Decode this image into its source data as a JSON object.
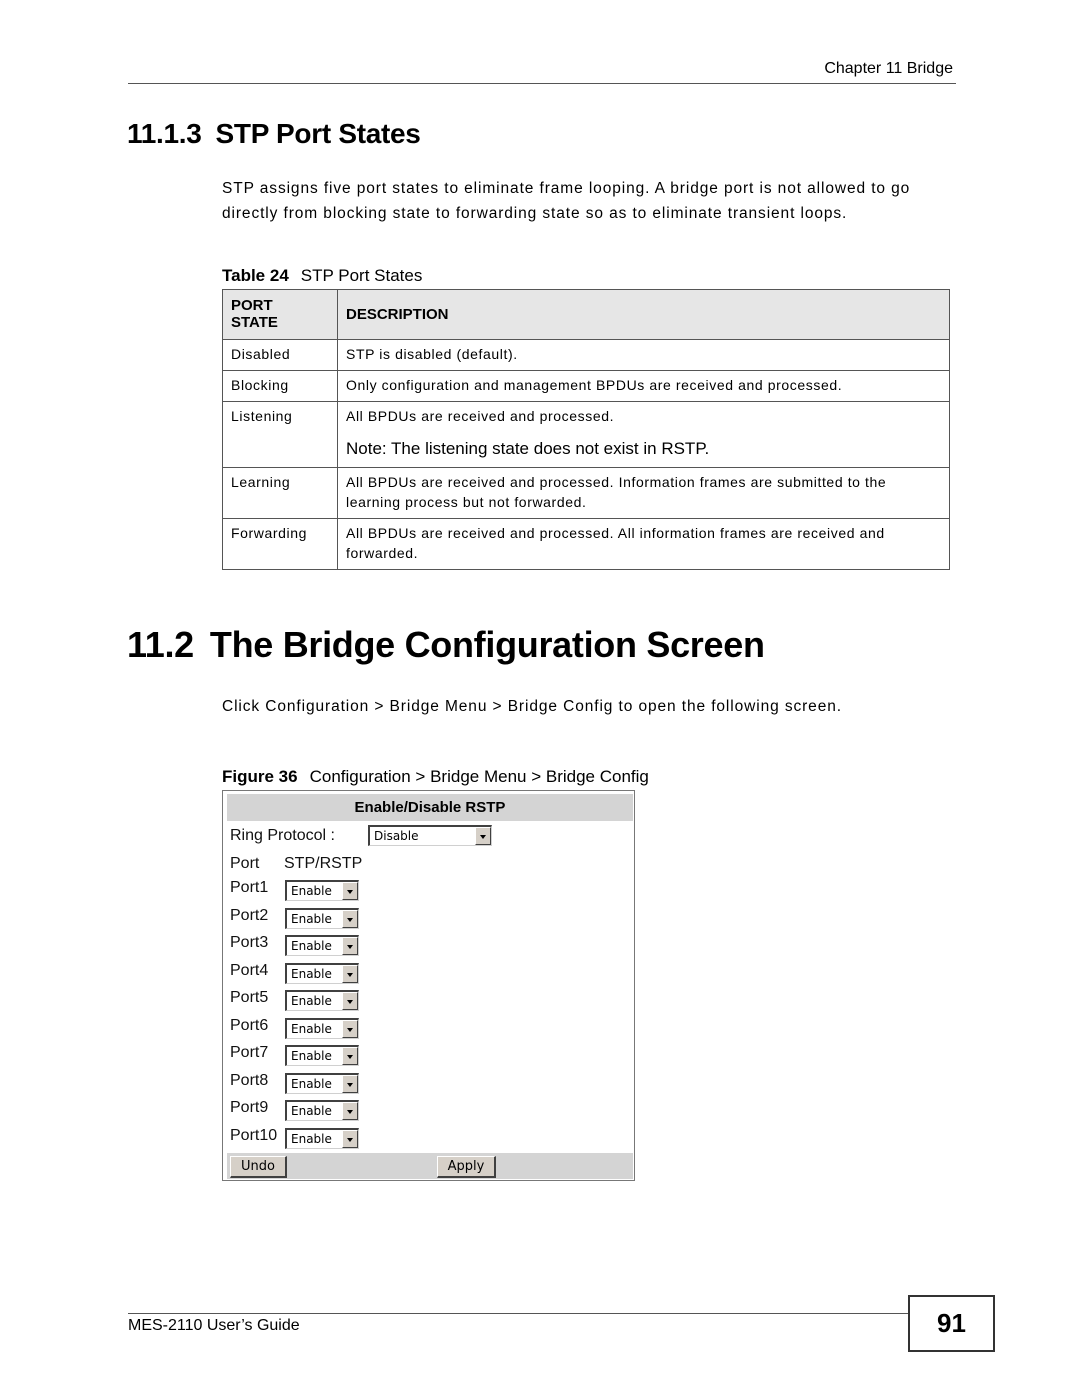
{
  "header": {
    "chapter": "Chapter 11 Bridge"
  },
  "section_stp": {
    "number": "11.1.3",
    "title": "STP Port States",
    "paragraph": "STP assigns five port states to eliminate frame looping. A bridge port is not allowed to go directly from blocking state to forwarding state so as to eliminate transient loops."
  },
  "table": {
    "caption_label": "Table 24",
    "caption_title": "STP Port States",
    "headers": {
      "col1_line1": "PORT",
      "col1_line2": "STATE",
      "col2": "DESCRIPTION"
    },
    "rows": [
      {
        "state": "Disabled",
        "description": "STP is disabled (default)."
      },
      {
        "state": "Blocking",
        "description": "Only configuration and management BPDUs are received and processed."
      },
      {
        "state": "Listening",
        "description": "All BPDUs are received and processed.",
        "note": "Note: The listening state does not exist in RSTP."
      },
      {
        "state": "Learning",
        "description": "All BPDUs are received and processed. Information frames are submitted to the learning process but not forwarded."
      },
      {
        "state": "Forwarding",
        "description": "All BPDUs are received and processed. All information frames are received and forwarded."
      }
    ]
  },
  "section_bridge": {
    "number": "11.2",
    "title": "The Bridge Configuration Screen",
    "paragraph": "Click Configuration > Bridge Menu > Bridge Config to open the following screen."
  },
  "figure": {
    "caption_label": "Figure 36",
    "caption_title": "Configuration > Bridge Menu > Bridge Config",
    "panel_title": "Enable/Disable RSTP",
    "ring_protocol_label": "Ring Protocol :",
    "ring_protocol_value": "Disable",
    "col_port": "Port",
    "col_stp": "STP/RSTP",
    "ports": [
      {
        "label": "Port1",
        "value": "Enable"
      },
      {
        "label": "Port2",
        "value": "Enable"
      },
      {
        "label": "Port3",
        "value": "Enable"
      },
      {
        "label": "Port4",
        "value": "Enable"
      },
      {
        "label": "Port5",
        "value": "Enable"
      },
      {
        "label": "Port6",
        "value": "Enable"
      },
      {
        "label": "Port7",
        "value": "Enable"
      },
      {
        "label": "Port8",
        "value": "Enable"
      },
      {
        "label": "Port9",
        "value": "Enable"
      },
      {
        "label": "Port10",
        "value": "Enable"
      }
    ],
    "undo_label": "Undo",
    "apply_label": "Apply"
  },
  "footer": {
    "guide": "MES-2110 User’s Guide",
    "page_number": "91"
  }
}
